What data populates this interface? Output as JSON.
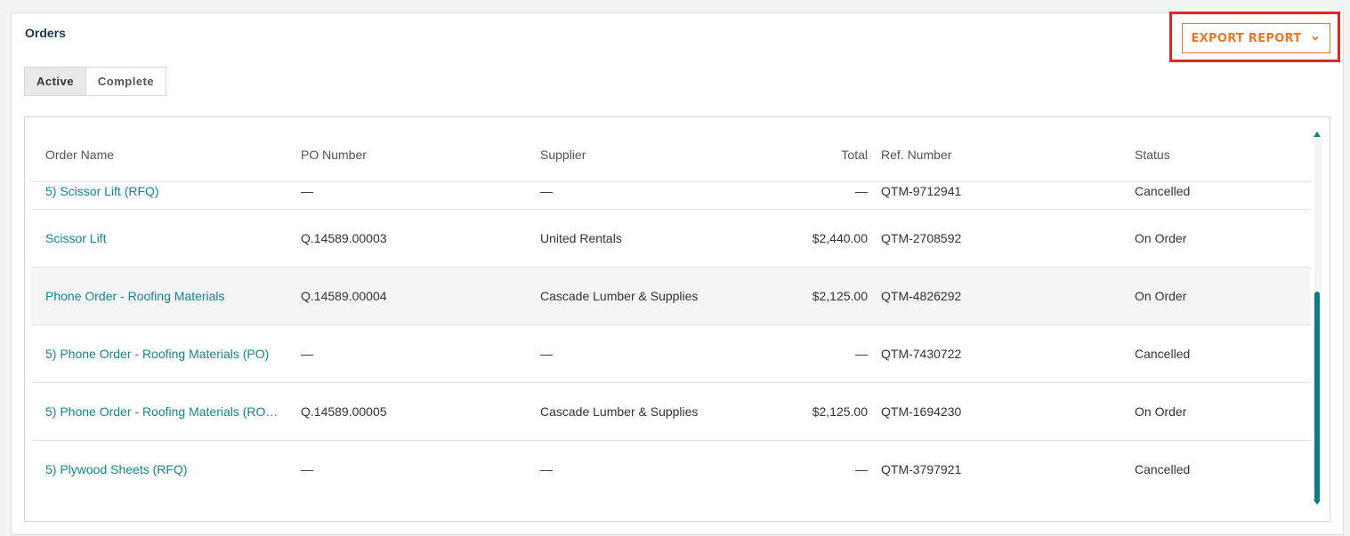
{
  "panel": {
    "title": "Orders",
    "export_label": "EXPORT REPORT",
    "accent_color": "#e9782a",
    "highlight_color": "#e2252b",
    "link_color": "#14858e"
  },
  "tabs": [
    {
      "label": "Active",
      "selected": true
    },
    {
      "label": "Complete",
      "selected": false
    }
  ],
  "table": {
    "columns": [
      "Order Name",
      "PO Number",
      "Supplier",
      "Total",
      "Ref. Number",
      "Status"
    ],
    "rows": [
      {
        "order_name": "5) Scissor Lift (RFQ)",
        "po": "—",
        "supplier": "—",
        "total": "—",
        "ref": "QTM-9712941",
        "status": "Cancelled"
      },
      {
        "order_name": "Scissor Lift",
        "po": "Q.14589.00003",
        "supplier": "United Rentals",
        "total": "$2,440.00",
        "ref": "QTM-2708592",
        "status": "On Order"
      },
      {
        "order_name": "Phone Order - Roofing Materials",
        "po": "Q.14589.00004",
        "supplier": "Cascade Lumber & Supplies",
        "total": "$2,125.00",
        "ref": "QTM-4826292",
        "status": "On Order"
      },
      {
        "order_name": "5) Phone Order - Roofing Materials (PO)",
        "po": "—",
        "supplier": "—",
        "total": "—",
        "ref": "QTM-7430722",
        "status": "Cancelled"
      },
      {
        "order_name": "5) Phone Order - Roofing Materials (RO…",
        "po": "Q.14589.00005",
        "supplier": "Cascade Lumber & Supplies",
        "total": "$2,125.00",
        "ref": "QTM-1694230",
        "status": "On Order"
      },
      {
        "order_name": "5) Plywood Sheets (RFQ)",
        "po": "—",
        "supplier": "—",
        "total": "—",
        "ref": "QTM-3797921",
        "status": "Cancelled"
      }
    ]
  },
  "icons": {
    "export_dropdown": "chevron-down-icon",
    "scroll_up": "scroll-up-arrow-icon",
    "scroll_down": "scroll-down-arrow-icon"
  }
}
